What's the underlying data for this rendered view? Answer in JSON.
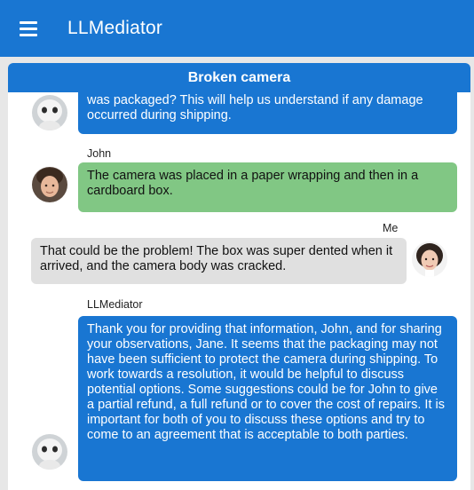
{
  "appbar": {
    "title": "LLMediator",
    "menu_icon": "menu-icon"
  },
  "chat": {
    "title": "Broken camera",
    "messages": [
      {
        "sender": "LLMediator",
        "text": "was packaged? This will help us understand if any damage occurred during shipping."
      },
      {
        "sender": "John",
        "text": "The camera was placed in a paper wrapping and then in a cardboard box."
      },
      {
        "sender": "Me",
        "text": "That could be the problem! The box was super dented when it arrived, and the camera body was cracked."
      },
      {
        "sender": "LLMediator",
        "text": "Thank you for providing that information, John, and for sharing your observations, Jane. It seems that the packaging may not have been sufficient to protect the camera during shipping. To work towards a resolution, it would be helpful to discuss potential options. Some suggestions could be for John to give a partial refund, a full refund or to cover the cost of repairs. It is important for both of you to discuss these options and try to come to an agreement that is acceptable to both parties."
      }
    ]
  },
  "colors": {
    "primary": "#1976d2",
    "john_bubble": "#81c784",
    "me_bubble": "#e0e0e0",
    "background": "#e7e7e7"
  }
}
